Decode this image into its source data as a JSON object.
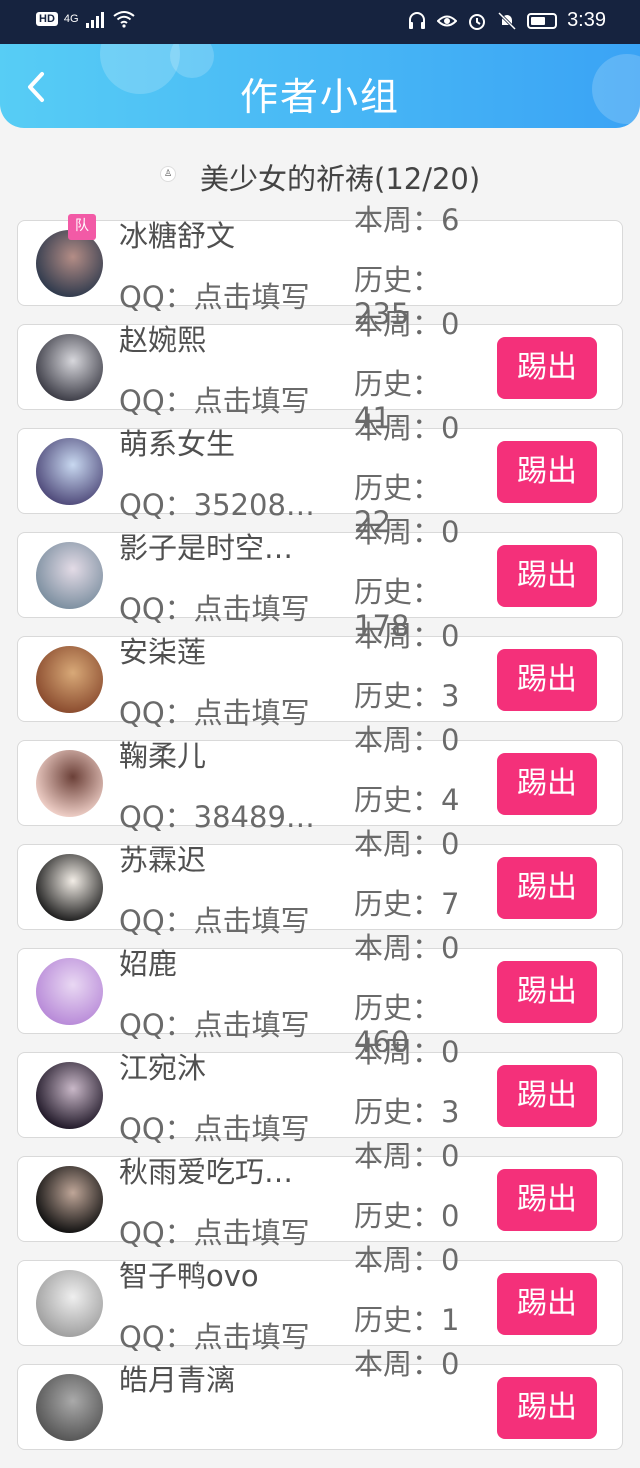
{
  "statusbar": {
    "network": "4G",
    "hd": "HD",
    "time": "3:39"
  },
  "header": {
    "title": "作者小组",
    "back_icon": "chevron-left-icon"
  },
  "group": {
    "name": "美少女的祈祷(12/20)"
  },
  "members": [
    {
      "name": "冰糖舒文",
      "qq": "QQ：点击填写",
      "week": "本周：6",
      "history": "历史：235",
      "badge": "队",
      "kick": "",
      "avatar_colors": [
        "#2f3a4d",
        "#b48d86"
      ]
    },
    {
      "name": "赵婉熙",
      "qq": "QQ：点击填写",
      "week": "本周：0",
      "history": "历史：41",
      "badge": "",
      "kick": "踢出",
      "avatar_colors": [
        "#3c3c46",
        "#d7d7dc"
      ]
    },
    {
      "name": "萌系女生",
      "qq": "QQ：35208…",
      "week": "本周：0",
      "history": "历史：22",
      "badge": "",
      "kick": "踢出",
      "avatar_colors": [
        "#4f4a7a",
        "#c8d8f0"
      ]
    },
    {
      "name": "影子是时空…",
      "qq": "QQ：点击填写",
      "week": "本周：0",
      "history": "历史：178",
      "badge": "",
      "kick": "踢出",
      "avatar_colors": [
        "#7c8fa0",
        "#e3dbe6"
      ]
    },
    {
      "name": "安柒莲",
      "qq": "QQ：点击填写",
      "week": "本周：0",
      "history": "历史：3",
      "badge": "",
      "kick": "踢出",
      "avatar_colors": [
        "#8a4b2e",
        "#d8a978"
      ]
    },
    {
      "name": "鞠柔儿",
      "qq": "QQ：38489…",
      "week": "本周：0",
      "history": "历史：4",
      "badge": "",
      "kick": "踢出",
      "avatar_colors": [
        "#f0d0c8",
        "#6b4038"
      ]
    },
    {
      "name": "苏霖迟",
      "qq": "QQ：点击填写",
      "week": "本周：0",
      "history": "历史：7",
      "badge": "",
      "kick": "踢出",
      "avatar_colors": [
        "#1e1e1e",
        "#f2ede6"
      ]
    },
    {
      "name": "妱鹿",
      "qq": "QQ：点击填写",
      "week": "本周：0",
      "history": "历史：460",
      "badge": "",
      "kick": "踢出",
      "avatar_colors": [
        "#b88ad8",
        "#e9d8f3"
      ]
    },
    {
      "name": "江宛沐",
      "qq": "QQ：点击填写",
      "week": "本周：0",
      "history": "历史：3",
      "badge": "",
      "kick": "踢出",
      "avatar_colors": [
        "#201828",
        "#c9b8c8"
      ]
    },
    {
      "name": "秋雨爱吃巧…",
      "qq": "QQ：点击填写",
      "week": "本周：0",
      "history": "历史：0",
      "badge": "",
      "kick": "踢出",
      "avatar_colors": [
        "#101010",
        "#bfa698"
      ]
    },
    {
      "name": "智子鸭ovo",
      "qq": "QQ：点击填写",
      "week": "本周：0",
      "history": "历史：1",
      "badge": "",
      "kick": "踢出",
      "avatar_colors": [
        "#9f9f9f",
        "#efefef"
      ]
    },
    {
      "name": "皓月青漓",
      "qq": "",
      "week": "本周：0",
      "history": "",
      "badge": "",
      "kick": "踢出",
      "avatar_colors": [
        "#555555",
        "#aaaaaa"
      ]
    }
  ]
}
